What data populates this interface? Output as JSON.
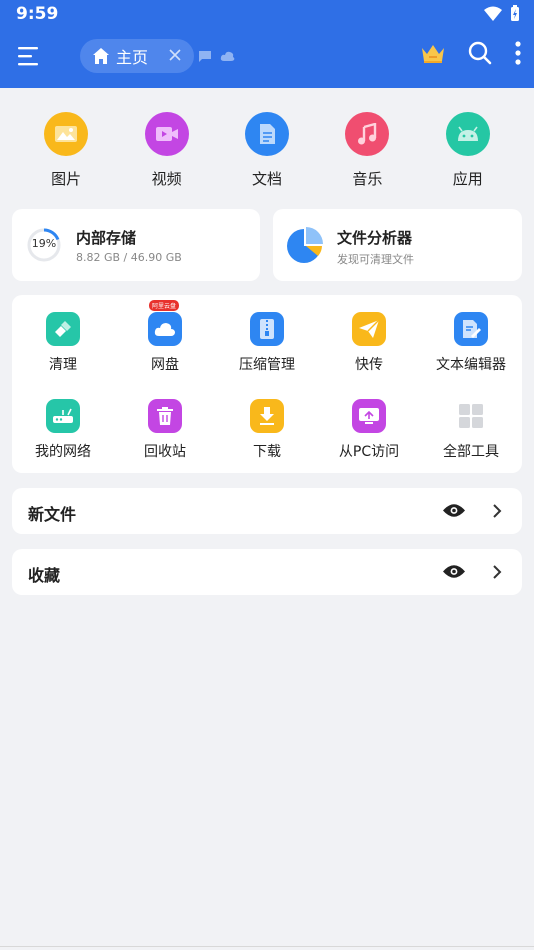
{
  "status": {
    "time": "9:59"
  },
  "appbar": {
    "home_tab_label": "主页"
  },
  "categories": [
    {
      "label": "图片",
      "color": "#f9b81b",
      "icon": "image-icon"
    },
    {
      "label": "视频",
      "color": "#c346e3",
      "icon": "video-icon"
    },
    {
      "label": "文档",
      "color": "#2e86f2",
      "icon": "document-icon"
    },
    {
      "label": "音乐",
      "color": "#f04e70",
      "icon": "music-icon"
    },
    {
      "label": "应用",
      "color": "#25c7a4",
      "icon": "android-icon"
    }
  ],
  "storage": {
    "percent_label": "19%",
    "percent": 19,
    "title": "内部存储",
    "detail": "8.82 GB / 46.90 GB"
  },
  "analyzer": {
    "title": "文件分析器",
    "subtitle": "发现可清理文件"
  },
  "tools": [
    {
      "label": "清理",
      "color": "#26c6a8",
      "icon": "broom-icon"
    },
    {
      "label": "网盘",
      "color": "#2e86f2",
      "icon": "cloud-icon",
      "badge": "阿里云盘"
    },
    {
      "label": "压缩管理",
      "color": "#2e86f2",
      "icon": "zip-icon"
    },
    {
      "label": "快传",
      "color": "#f9b81b",
      "icon": "send-icon"
    },
    {
      "label": "文本编辑器",
      "color": "#2e86f2",
      "icon": "text-edit-icon"
    },
    {
      "label": "我的网络",
      "color": "#26c6a8",
      "icon": "router-icon"
    },
    {
      "label": "回收站",
      "color": "#c346e3",
      "icon": "trash-icon"
    },
    {
      "label": "下载",
      "color": "#f9b81b",
      "icon": "download-icon"
    },
    {
      "label": "从PC访问",
      "color": "#c346e3",
      "icon": "monitor-icon"
    },
    {
      "label": "全部工具",
      "color": "#d5d7db",
      "icon": "grid-icon"
    }
  ],
  "sections": {
    "new_files": "新文件",
    "favorites": "收藏"
  }
}
